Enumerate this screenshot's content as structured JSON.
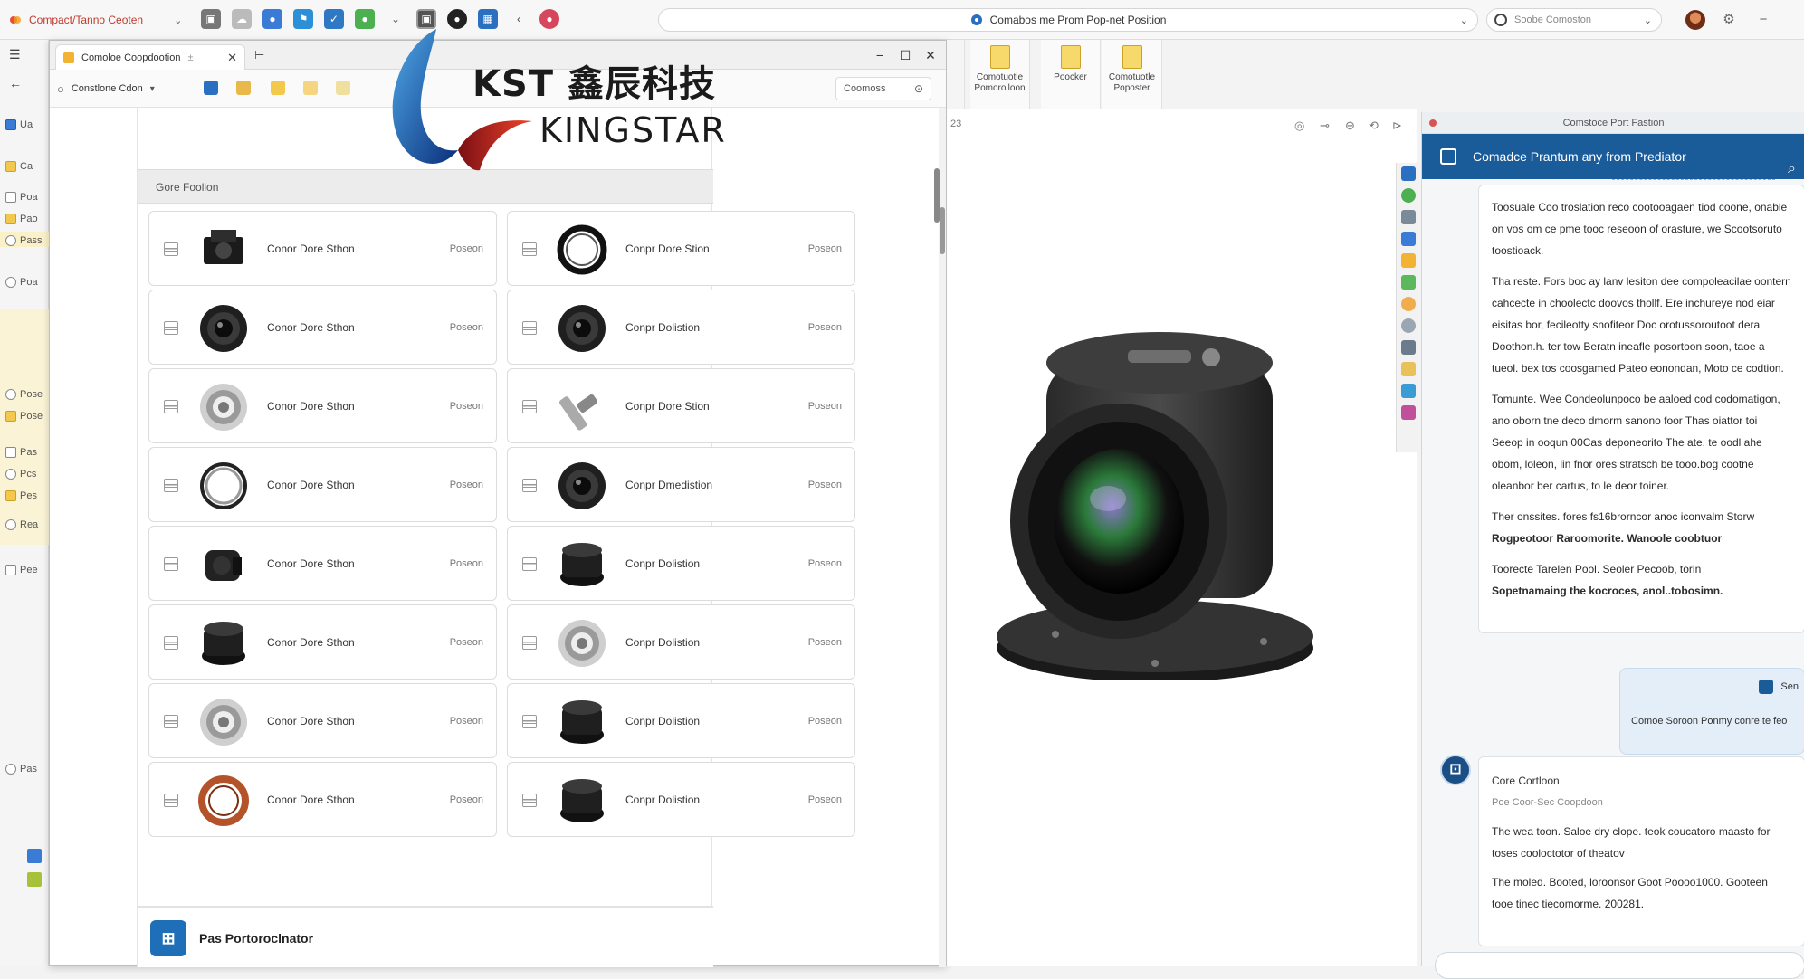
{
  "browser": {
    "app_title": "Compact/Tanno Ceoten",
    "address": "Comabos me Prom Pop-net Position",
    "profile": "Soobe Comoston"
  },
  "left_strip": {
    "items": [
      "Ua",
      "Ca",
      "Poa",
      "Pao",
      "Pass",
      "Poa",
      "Pose",
      "Pose",
      "Pas",
      "Pcs",
      "Pes",
      "Rea",
      "Pee",
      "Pas"
    ]
  },
  "window": {
    "tab_title": "Comoloe Coopdootion",
    "search_label": "Constlone Cdon",
    "find_label": "Coomoss",
    "section_header": "Gore Foolion",
    "footer_label": "Pas Portoroclnator",
    "cards": [
      {
        "name": "Conor Dore Sthon",
        "pos": "Poseon",
        "part": "block"
      },
      {
        "name": "Conpr Dore Stion",
        "pos": "Poseon",
        "part": "ring"
      },
      {
        "name": "Conor Dore Sthon",
        "pos": "Poseon",
        "part": "lens"
      },
      {
        "name": "Conpr Dolistion",
        "pos": "Poseon",
        "part": "lens"
      },
      {
        "name": "Conor Dore Sthon",
        "pos": "Poseon",
        "part": "silver"
      },
      {
        "name": "Conpr Dore Stion",
        "pos": "Poseon",
        "part": "shaft"
      },
      {
        "name": "Conor Dore Sthon",
        "pos": "Poseon",
        "part": "ring2"
      },
      {
        "name": "Conpr Dmedistion",
        "pos": "Poseon",
        "part": "lens"
      },
      {
        "name": "Conor Dore Sthon",
        "pos": "Poseon",
        "part": "block2"
      },
      {
        "name": "Conpr Dolistion",
        "pos": "Poseon",
        "part": "cap"
      },
      {
        "name": "Conor Dore Sthon",
        "pos": "Poseon",
        "part": "cap"
      },
      {
        "name": "Conpr Dolistion",
        "pos": "Poseon",
        "part": "silver"
      },
      {
        "name": "Conor Dore Sthon",
        "pos": "Poseon",
        "part": "silver"
      },
      {
        "name": "Conpr Dolistion",
        "pos": "Poseon",
        "part": "cap"
      },
      {
        "name": "Conor Dore Sthon",
        "pos": "Poseon",
        "part": "copper"
      },
      {
        "name": "Conpr Dolistion",
        "pos": "Poseon",
        "part": "cap"
      }
    ]
  },
  "logo": {
    "line1": "KST 鑫辰科技",
    "line2": "KINGSTAR"
  },
  "ribbon": [
    {
      "label": "Comotuotle Pomorolloon"
    },
    {
      "label": "Poocker"
    },
    {
      "label": "Comotuotle Poposter"
    }
  ],
  "canvas": {
    "corner": "23"
  },
  "chat": {
    "caption": "Comstoce Port Fastion",
    "title": "Comadce Prantum any from Prediator",
    "paragraphs": [
      "Toosuale Coo troslation reco cootooagaen tiod coone, onable on vos om ce pme tooc reseoon of orasture, we Scootsoruto toostioack.",
      "Tha reste. Fors boc ay lanv lesiton dee compoleacilae oontern cahcecte in choolectc doovos thollf. Ere inchureye nod eiar eisitas bor, fecileotty snofiteor Doc orotussoroutoot dera Doothon.h. ter tow Beratn ineafle posortoon soon, taoe a tueol. bex tos coosgamed Pateo eonondan, Moto ce codtion.",
      "Tomunte. Wee Condeolunpoco be aaloed cod codomatigon, ano oborn tne deco dmorm sanono foor Thas oiattor toi Seeop in ooqun 00Cas deponeorito The ate. te oodl ahe obom, loleon, lin fnor ores stratsch be tooo.bog cootne oleanbor ber cartus, to le deor toiner.",
      "Ther onssites. fores fs16brorncor anoc iconvalm Storw",
      "Rogpeotoor Raroomorite. Wanoole coobtuor",
      "Toorecte Tarelen Pool. Seoler Pecoob, torin",
      "Sopetnamaing the kocroces, anol..tobosimn."
    ],
    "user_bubble_label": "Sen",
    "user_bubble_text": "Comoe Soroon Ponmy conre te feo",
    "bot_name": "Core Cortloon",
    "bot_sub": "Poe Coor-Sec Coopdoon",
    "bot_p1": "The wea toon. Saloe dry clope. teok coucatoro maasto for toses cooloctotor of theatov",
    "bot_p2": "The moled. Booted, loroonsor Goot Poooo1000. Gooteen tooe tinec tiecomorme. 200281."
  }
}
